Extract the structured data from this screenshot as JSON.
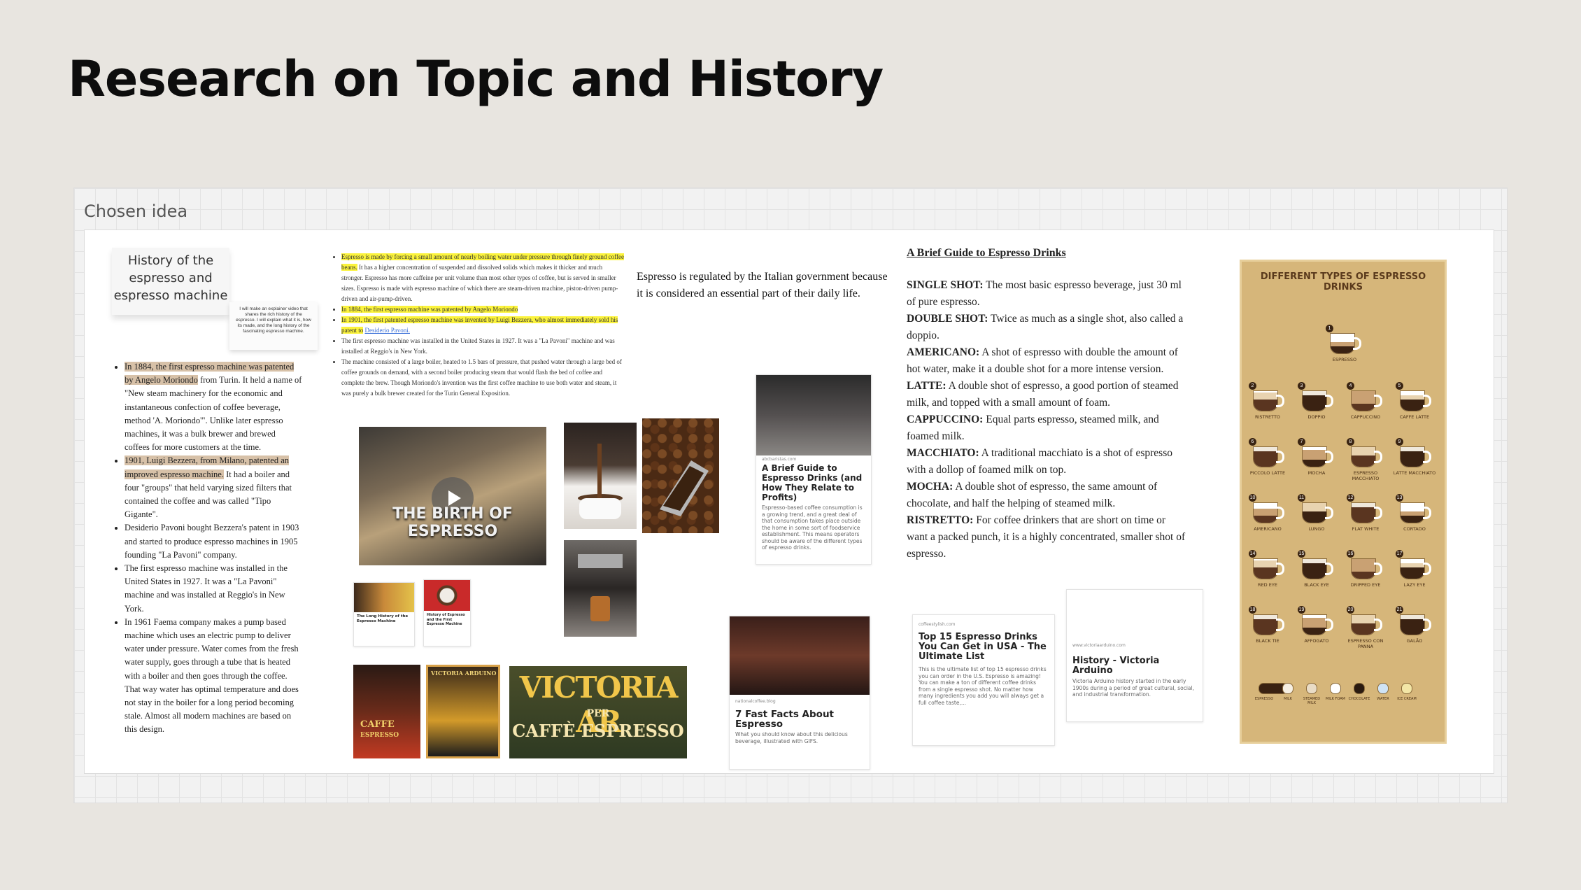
{
  "slide": {
    "title": "Research on Topic and History"
  },
  "board": {
    "label": "Chosen idea"
  },
  "sticky": {
    "main": "History of the espresso and espresso machine",
    "note": "I will make an explainer video that shares the rich history of the espresso. I will explain what it is, how its made, and the long history of the fascinating espresso machine."
  },
  "left_doc": {
    "p1_hl": "In 1884, the first espresso machine was patented by Angelo Moriondo",
    "p1_rest": " from Turin. It held a name of \"New steam machinery for the economic and instantaneous confection of coffee beverage, method 'A. Moriondo'\". Unlike later espresso machines, it was a bulk brewer and brewed coffees for more customers at the time.",
    "p2_hl": "1901, Luigi Bezzera, from Milano, patented an improved espresso machine.",
    "p2_rest": " It had a boiler and four \"groups\" that held varying sized filters that contained the coffee and was called \"Tipo Gigante\".",
    "p3": "Desiderio Pavoni bought Bezzera's patent in 1903 and started to produce espresso machines in 1905 founding \"La Pavoni\" company.",
    "p4": "The first espresso machine was installed in the United States in 1927. It was a \"La Pavoni\" machine and was installed at Reggio's in New York.",
    "p5": "In 1961 Faema company makes a pump based machine which uses an electric pump to deliver water under pressure. Water comes from the fresh water supply, goes through a tube that is heated with a boiler and then goes through the coffee. That way water has optimal temperature and does not stay in the boiler for a long period becoming stale. Almost all modern machines are based on this design."
  },
  "mid_doc": {
    "p1_hl": "Espresso is made by forcing a small amount of nearly boiling water under pressure through finely ground coffee beans.",
    "p1_rest": " It has a higher concentration of suspended and dissolved solids which makes it thicker and much stronger. Espresso has more caffeine per unit volume than most other types of coffee, but is served in smaller sizes. Espresso is made with espresso machine of which there are steam-driven machine, piston-driven pump-driven and air-pump-driven.",
    "p2_hl": "In 1884, the first espresso machine was patented by Angelo Moriondo",
    "p3_hl": "In 1901, the first patented espresso machine was invented by Luigi Bezzera, who almost immediately sold his patent to",
    "p3_link": "Desiderio Pavoni.",
    "p4": "The first espresso machine was installed in the United States in 1927. It was a \"La Pavoni\" machine and was installed at Reggio's in New York.",
    "p5": "The machine consisted of a large boiler, heated to 1.5 bars of pressure, that pushed water through a large bed of coffee grounds on demand, with a second boiler producing steam that would flash the bed of coffee and complete the brew. Though Moriondo's invention was the first coffee machine to use both water and steam, it was purely a bulk brewer created for the Turin General Exposition."
  },
  "quote": "Espresso is regulated by the Italian government because it is considered an essential part of their daily life.",
  "guide": {
    "title": "A Brief Guide to Espresso Drinks",
    "items": [
      {
        "term": "SINGLE SHOT:",
        "def": " The most basic espresso beverage, just 30 ml of pure espresso."
      },
      {
        "term": "DOUBLE SHOT:",
        "def": " Twice as much as a single shot, also called a doppio."
      },
      {
        "term": "AMERICANO:",
        "def": " A shot of espresso with double the amount of hot water, make it a double shot for a more intense version."
      },
      {
        "term": "LATTE:",
        "def": " A double shot of espresso, a good portion of steamed milk, and topped with a small amount of foam."
      },
      {
        "term": "CAPPUCCINO:",
        "def": " Equal parts espresso, steamed milk, and foamed milk."
      },
      {
        "term": "MACCHIATO:",
        "def": " A traditional macchiato is a shot of espresso with a dollop of foamed milk on top."
      },
      {
        "term": "MOCHA:",
        "def": " A double shot of espresso, the same amount of chocolate, and half the helping of steamed milk."
      },
      {
        "term": "RISTRETTO:",
        "def": " For coffee drinkers that are short on time or want a packed punch, it is a highly concentrated, smaller shot of espresso."
      }
    ]
  },
  "video": {
    "title": "THE BIRTH OF ESPRESSO"
  },
  "small_cards": [
    {
      "title": "The Long History of the Espresso Machine"
    },
    {
      "title": "History of Espresso and the First Espresso Machine"
    }
  ],
  "poster": {
    "line1": "VICTORIA AR",
    "line2": "PER",
    "line3": "CAFFÈ ESPRESSO",
    "small1": "CAFFE",
    "small2": "ESPRESSO",
    "small3": "VICTORIA ARDUINO"
  },
  "cards": {
    "brief": {
      "source": "abcbaristas.com",
      "title": "A Brief Guide to Espresso Drinks (and How They Relate to Profits)",
      "desc": "Espresso-based coffee consumption is a growing trend, and a great deal of that consumption takes place outside the home in some sort of foodservice establishment. This means operators should be aware of the different types of espresso drinks."
    },
    "facts": {
      "source": "nationalcoffee.blog",
      "title": "7 Fast Facts About Espresso",
      "desc": "What you should know about this delicious beverage, illustrated with GIFS."
    },
    "top15": {
      "source": "coffeestylish.com",
      "title": "Top 15 Espresso Drinks You Can Get in USA - The Ultimate List",
      "desc": "This is the ultimate list of top 15 espresso drinks you can order in the U.S. Espresso is amazing! You can make a ton of different coffee drinks from a single espresso shot. No matter how many ingredients you add you will always get a full coffee taste,..."
    },
    "arduino": {
      "source": "www.victoriaarduino.com",
      "title": "History - Victoria Arduino",
      "desc": "Victoria Arduino history started in the early 1900s during a period of great cultural, social, and industrial transformation."
    }
  },
  "infographic": {
    "title": "DIFFERENT TYPES OF ESPRESSO DRINKS",
    "drinks": [
      "ESPRESSO",
      "RISTRETTO",
      "DOPPIO",
      "CAPPUCCINO",
      "CAFFE LATTE",
      "PICCOLO LATTE",
      "MOCHA",
      "ESPRESSO MACCHIATO",
      "LATTE MACCHIATO",
      "AMERICANO",
      "LUNGO",
      "FLAT WHITE",
      "CORTADO",
      "RED EYE",
      "BLACK EYE",
      "DRIPPED EYE",
      "LAZY EYE",
      "BLACK TIE",
      "AFFOGATO",
      "ESPRESSO CON PANNA",
      "GALÃO"
    ],
    "legend": [
      "ESPRESSO",
      "MILK",
      "STEAMED MILK",
      "MILK FOAM",
      "CHOCOLATE",
      "WATER",
      "ICE CREAM"
    ]
  }
}
